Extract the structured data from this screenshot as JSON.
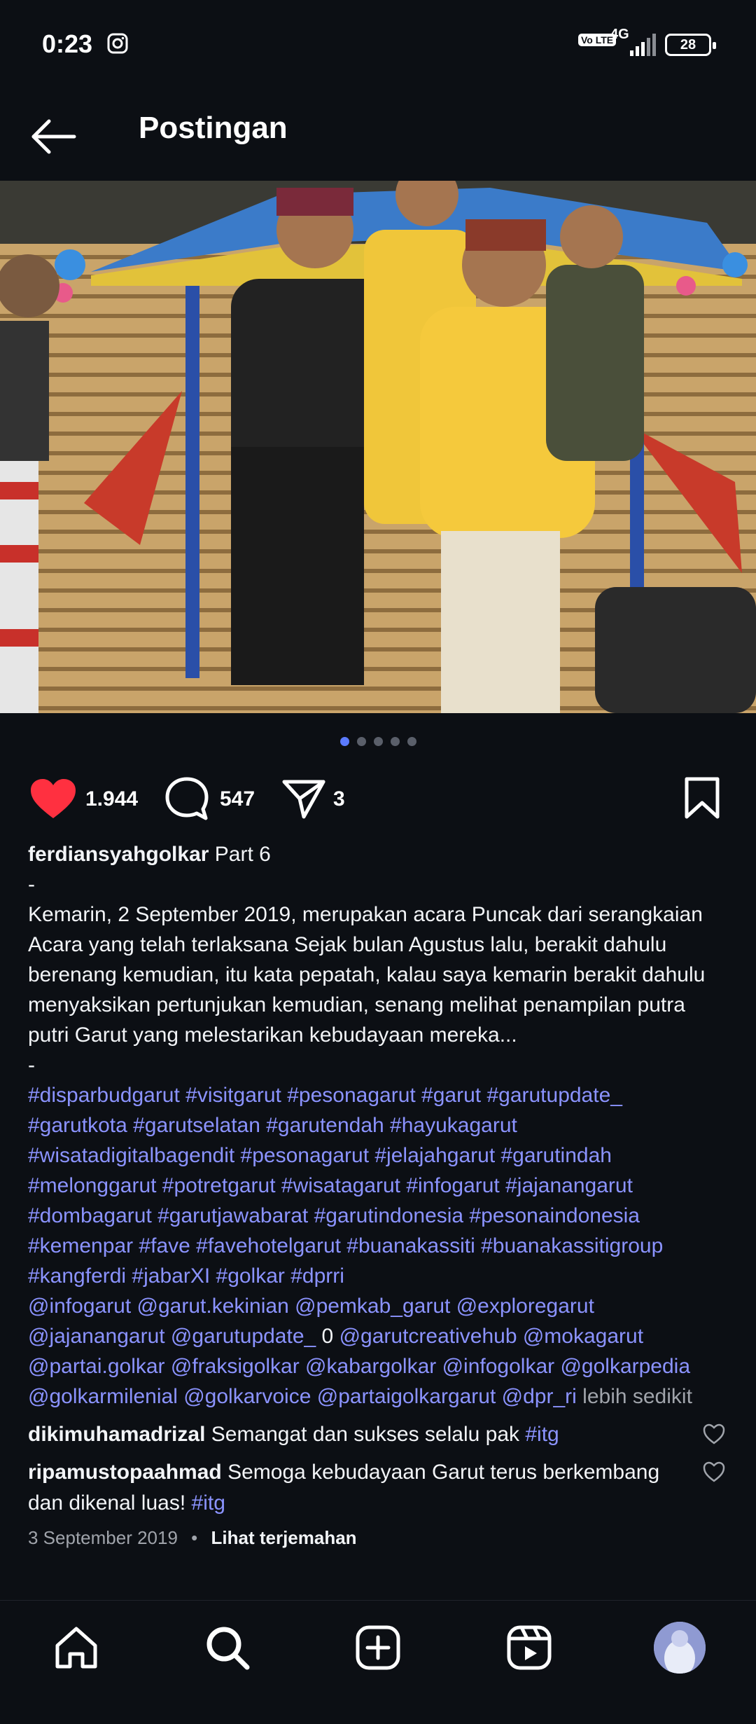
{
  "status_bar": {
    "time": "0:23",
    "network": "4G",
    "volte": "Vo LTE",
    "battery": "28",
    "icons": [
      "instagram-icon",
      "signal-icon",
      "battery-icon"
    ]
  },
  "header": {
    "title": "Postingan",
    "back_icon": "arrow-left-icon"
  },
  "carousel": {
    "count": 5,
    "active_index": 0,
    "active_color": "#5b7bff"
  },
  "actions": {
    "likes": "1.944",
    "comments": "547",
    "shares": "3",
    "like_color": "#ff3040"
  },
  "caption": {
    "username": "ferdiansyahgolkar",
    "first_line": "Part 6",
    "dash1": "-",
    "body": [
      "Kemarin, 2 September 2019, merupakan acara Puncak dari serangkaian",
      "Acara yang telah terlaksana Sejak bulan Agustus lalu, berakit dahulu",
      "berenang kemudian, itu kata pepatah, kalau saya kemarin berakit dahulu",
      "menyaksikan pertunjukan kemudian, senang melihat penampilan putra",
      "putri Garut yang melestarikan kebudayaan mereka..."
    ],
    "dash2": "-",
    "hashtags": [
      "#disparbudgarut #visitgarut #pesonagarut #garut #garutupdate_",
      "#garutkota #garutselatan #garutendah #hayukagarut",
      "#wisatadigitalbagendit #pesonagarut #jelajahgarut #garutindah",
      "#melonggarut #potretgarut #wisatagarut #infogarut #jajanangarut",
      "#dombagarut #garutjawabarat #garutindonesia #pesonaindonesia",
      "#kemenpar #fave #favehotelgarut #buanakassiti #buanakassitigroup",
      "#kangferdi #jabarXI #golkar #dprri"
    ],
    "mentions_line1": "@infogarut @garut.kekinian @pemkab_garut @exploregarut",
    "mentions_line2a": "@jajanangarut @garutupdate_",
    "mentions_line2_zero": "0",
    "mentions_line2b": "@garutcreativehub @mokagarut",
    "mentions_line3": "@partai.golkar @fraksigolkar @kabargolkar @infogolkar @golkarpedia",
    "mentions_line4": "@golkarmilenial @golkarvoice @partaigolkargarut @dpr_ri",
    "less": "lebih sedikit"
  },
  "comments": [
    {
      "user": "dikimuhamadrizal",
      "text": "Semangat dan sukses selalu pak",
      "tag": "#itg"
    },
    {
      "user": "ripamustopaahmad",
      "text": "Semoga kebudayaan Garut terus berkembang",
      "text2": "dan dikenal luas!",
      "tag": "#itg"
    }
  ],
  "meta": {
    "date": "3 September 2019",
    "separator": "•",
    "translate": "Lihat terjemahan"
  },
  "nav": [
    "home-icon",
    "search-icon",
    "create-icon",
    "reels-icon",
    "profile-avatar"
  ]
}
